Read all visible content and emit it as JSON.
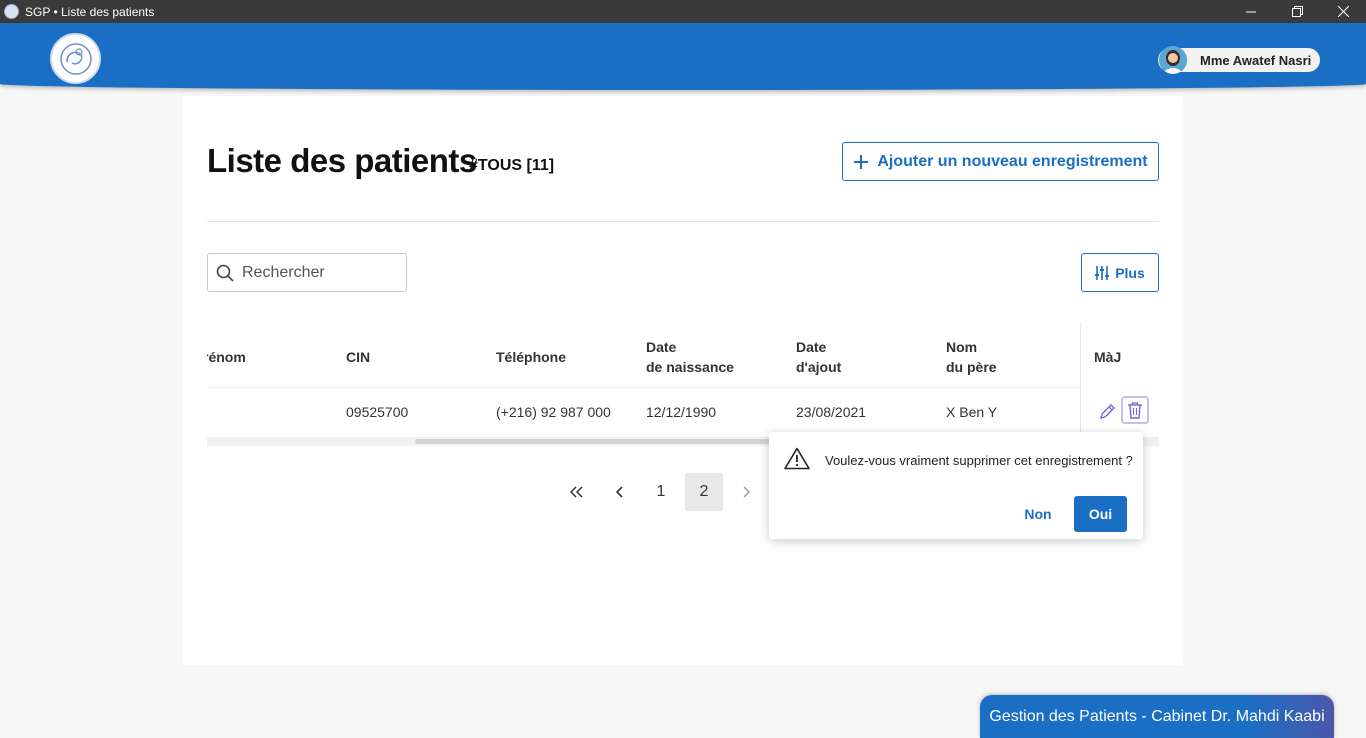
{
  "window": {
    "title": "SGP • Liste des patients",
    "controls": [
      "minimize-icon",
      "restore-icon",
      "close-icon"
    ]
  },
  "header": {
    "user_name": "Mme Awatef Nasri",
    "color": "#1a6fc4"
  },
  "page": {
    "title": "Liste des patients",
    "tag": "#TOUS [11]",
    "add_button": "Ajouter un nouveau enregistrement",
    "search_placeholder": "Rechercher",
    "more_button": "Plus"
  },
  "table": {
    "headers": {
      "prenom": "rénom",
      "cin": "CIN",
      "telephone": "Téléphone",
      "date_naissance_1": "Date",
      "date_naissance_2": "de naissance",
      "date_ajout_1": "Date",
      "date_ajout_2": "d'ajout",
      "nom_pere_1": "Nom",
      "nom_pere_2": "du père",
      "maj": "MàJ"
    },
    "rows": [
      {
        "prenom": "",
        "cin": "09525700",
        "telephone": "(+216) 92 987 000",
        "date_naissance": "12/12/1990",
        "date_ajout": "23/08/2021",
        "nom_pere": "X Ben Y"
      }
    ]
  },
  "pagination": {
    "first": "«",
    "prev": "‹",
    "pages": [
      "1",
      "2"
    ],
    "current": "2",
    "next": "›"
  },
  "confirm": {
    "message": "Voulez-vous vraiment supprimer cet enregistrement ?",
    "no": "Non",
    "yes": "Oui"
  },
  "footer": {
    "label": "Gestion des Patients - Cabinet Dr. Mahdi Kaabi"
  },
  "colors": {
    "accent": "#1a6fc4",
    "edit_icon": "#6b5fd6",
    "trash_outline": "#c6bdf2"
  }
}
